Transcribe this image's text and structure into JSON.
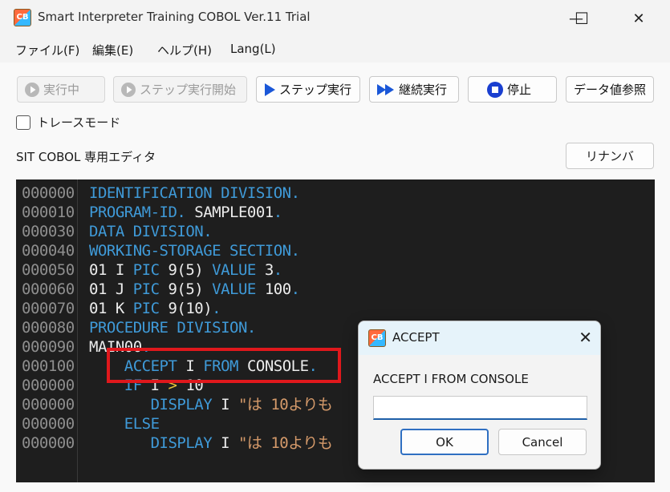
{
  "window": {
    "title": "Smart Interpreter Training COBOL Ver.11 Trial",
    "icon_text": "CB",
    "controls": {
      "minimize": "—",
      "maximize": "☐",
      "close": "✕"
    }
  },
  "menu": {
    "items": [
      {
        "label": "ファイル(F)"
      },
      {
        "label": "編集(E)"
      },
      {
        "label": "ヘルプ(H)"
      },
      {
        "label": "Lang(L)"
      }
    ]
  },
  "toolbar": {
    "run_label": "実行中",
    "step_start_label": "ステップ実行開始",
    "step_label": "ステップ実行",
    "continue_label": "継続実行",
    "stop_label": "停止",
    "data_ref_label": "データ値参照"
  },
  "trace_mode": {
    "label": "トレースモード",
    "checked": false
  },
  "editor_label": "SIT COBOL 専用エディタ",
  "renumber_label": "リナンバ",
  "code_lines": [
    {
      "num": "000000",
      "parts": [
        {
          "t": "IDENTIFICATION DIVISION.",
          "c": "kw"
        }
      ]
    },
    {
      "num": "000010",
      "parts": [
        {
          "t": "PROGRAM-ID.",
          "c": "kw"
        },
        {
          "t": " SAMPLE001",
          "c": "tx"
        },
        {
          "t": ".",
          "c": "kw"
        }
      ]
    },
    {
      "num": "000030",
      "parts": [
        {
          "t": "DATA DIVISION.",
          "c": "kw"
        }
      ]
    },
    {
      "num": "000040",
      "parts": [
        {
          "t": "WORKING-STORAGE SECTION.",
          "c": "kw"
        }
      ]
    },
    {
      "num": "000050",
      "parts": [
        {
          "t": "01 I ",
          "c": "tx"
        },
        {
          "t": "PIC",
          "c": "kw"
        },
        {
          "t": " 9(5) ",
          "c": "tx"
        },
        {
          "t": "VALUE",
          "c": "kw"
        },
        {
          "t": " 3",
          "c": "tx"
        },
        {
          "t": ".",
          "c": "kw"
        }
      ]
    },
    {
      "num": "000060",
      "parts": [
        {
          "t": "01 J ",
          "c": "tx"
        },
        {
          "t": "PIC",
          "c": "kw"
        },
        {
          "t": " 9(5) ",
          "c": "tx"
        },
        {
          "t": "VALUE",
          "c": "kw"
        },
        {
          "t": " 100",
          "c": "tx"
        },
        {
          "t": ".",
          "c": "kw"
        }
      ]
    },
    {
      "num": "000070",
      "parts": [
        {
          "t": "01 K ",
          "c": "tx"
        },
        {
          "t": "PIC",
          "c": "kw"
        },
        {
          "t": " 9(10)",
          "c": "tx"
        },
        {
          "t": ".",
          "c": "kw"
        }
      ]
    },
    {
      "num": "000080",
      "parts": [
        {
          "t": "PROCEDURE DIVISION.",
          "c": "kw"
        }
      ]
    },
    {
      "num": "000090",
      "parts": [
        {
          "t": "MAIN00",
          "c": "tx"
        },
        {
          "t": ".",
          "c": "kw"
        }
      ]
    },
    {
      "num": "000100",
      "parts": [
        {
          "t": "    ",
          "c": "tx"
        },
        {
          "t": "ACCEPT",
          "c": "kw"
        },
        {
          "t": " I ",
          "c": "tx"
        },
        {
          "t": "FROM",
          "c": "kw"
        },
        {
          "t": " CONSOLE",
          "c": "tx"
        },
        {
          "t": ".",
          "c": "kw"
        }
      ]
    },
    {
      "num": "000000",
      "parts": [
        {
          "t": "    ",
          "c": "tx"
        },
        {
          "t": "IF",
          "c": "kw"
        },
        {
          "t": " I ",
          "c": "tx"
        },
        {
          "t": ">",
          "c": "op"
        },
        {
          "t": " 10",
          "c": "tx"
        }
      ]
    },
    {
      "num": "000000",
      "parts": [
        {
          "t": "       ",
          "c": "tx"
        },
        {
          "t": "DISPLAY",
          "c": "kw"
        },
        {
          "t": " I ",
          "c": "tx"
        },
        {
          "t": "\"は 10よりも",
          "c": "st"
        }
      ]
    },
    {
      "num": "000000",
      "parts": [
        {
          "t": "    ",
          "c": "tx"
        },
        {
          "t": "ELSE",
          "c": "kw"
        }
      ]
    },
    {
      "num": "000000",
      "parts": [
        {
          "t": "       ",
          "c": "tx"
        },
        {
          "t": "DISPLAY",
          "c": "kw"
        },
        {
          "t": " I ",
          "c": "tx"
        },
        {
          "t": "\"は 10よりも",
          "c": "st"
        }
      ]
    }
  ],
  "dialog": {
    "title": "ACCEPT",
    "prompt": "ACCEPT I FROM CONSOLE",
    "input_value": "",
    "ok_label": "OK",
    "cancel_label": "Cancel"
  },
  "colors": {
    "editor_bg": "#1e1e1e",
    "keyword": "#3f9ad8",
    "text": "#ececec",
    "string": "#d59a6a",
    "operator": "#e6c23a",
    "highlight": "#e0181c",
    "step_icon": "#1a57d8"
  }
}
